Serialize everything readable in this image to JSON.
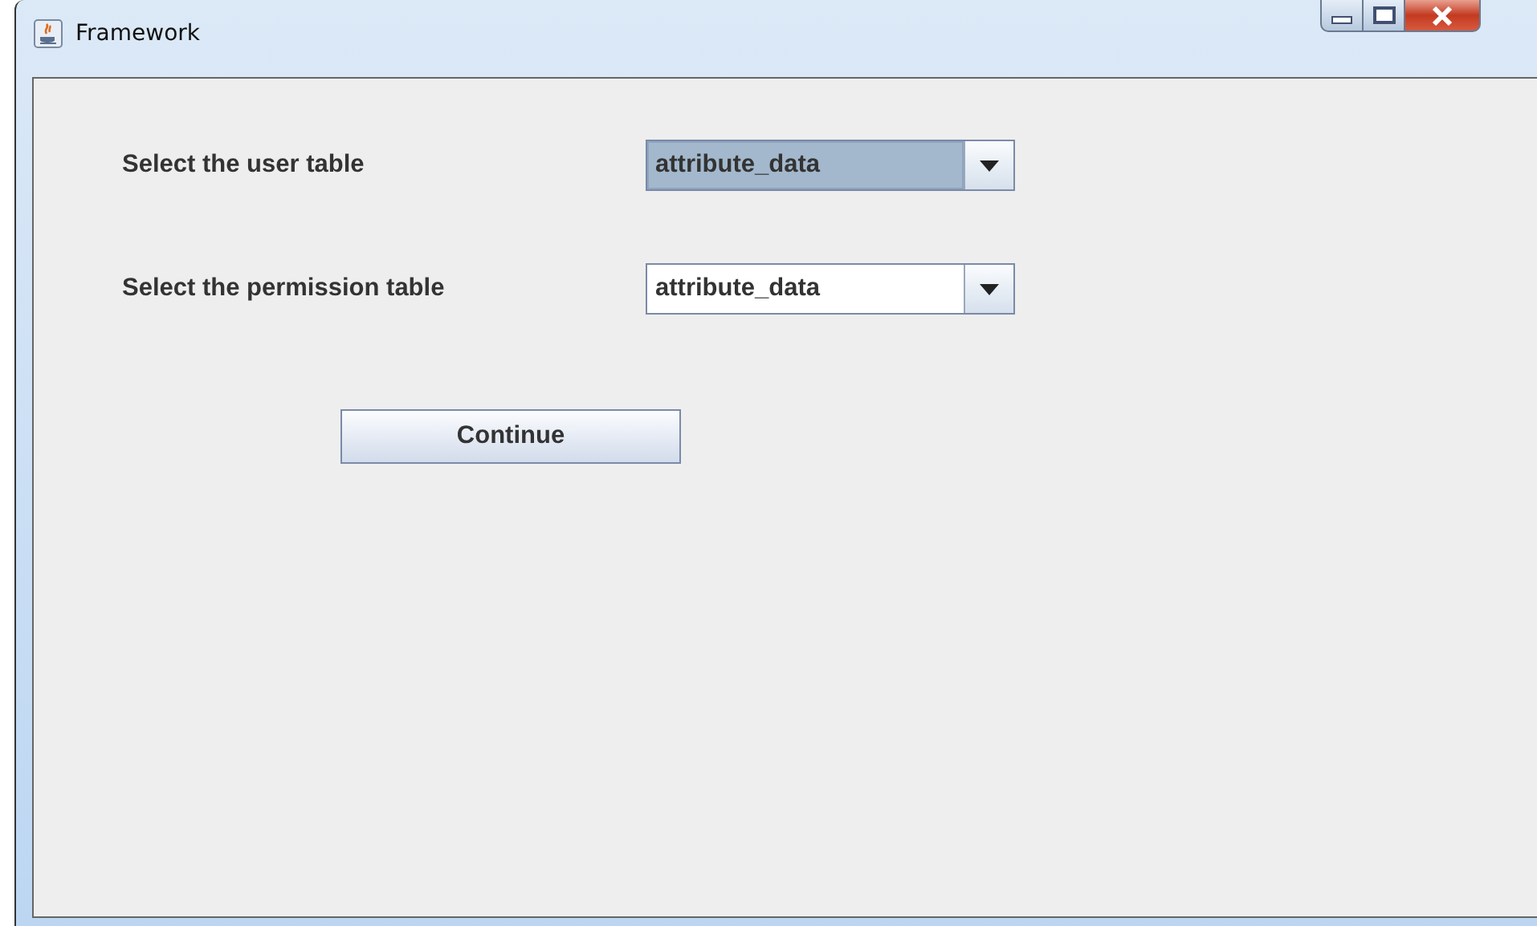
{
  "window": {
    "title": "Framework"
  },
  "fields": [
    {
      "label": "Select the user table",
      "value": "attribute_data",
      "focused": true
    },
    {
      "label": "Select the permission table",
      "value": "attribute_data",
      "focused": false
    }
  ],
  "buttons": [
    "Continue"
  ]
}
